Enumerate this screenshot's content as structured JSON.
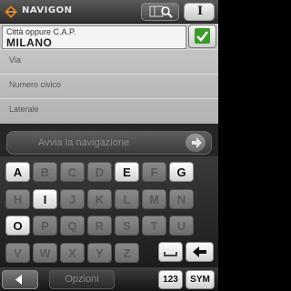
{
  "header": {
    "brand": "NAVIGON",
    "search_icon": "map-search-icon",
    "info_label": "I"
  },
  "form": {
    "city_label": "Città oppure C.A.P.",
    "city_value": "MILANO",
    "ok_icon": "checkmark-icon",
    "street_placeholder": "Via",
    "house_number_placeholder": "Numero civico",
    "cross_street_placeholder": "Laterale"
  },
  "start_navigation": {
    "label": "Avvia la navigazione",
    "icon": "arrow-right-icon"
  },
  "keyboard": {
    "row1": [
      {
        "key": "A",
        "enabled": true
      },
      {
        "key": "B",
        "enabled": false
      },
      {
        "key": "C",
        "enabled": false
      },
      {
        "key": "D",
        "enabled": false
      },
      {
        "key": "E",
        "enabled": true
      },
      {
        "key": "F",
        "enabled": false
      },
      {
        "key": "G",
        "enabled": true
      }
    ],
    "row2": [
      {
        "key": "H",
        "enabled": false
      },
      {
        "key": "I",
        "enabled": true
      },
      {
        "key": "J",
        "enabled": false
      },
      {
        "key": "K",
        "enabled": false
      },
      {
        "key": "L",
        "enabled": false
      },
      {
        "key": "M",
        "enabled": false
      },
      {
        "key": "N",
        "enabled": false
      }
    ],
    "row3": [
      {
        "key": "O",
        "enabled": true
      },
      {
        "key": "P",
        "enabled": false
      },
      {
        "key": "Q",
        "enabled": false
      },
      {
        "key": "R",
        "enabled": false
      },
      {
        "key": "S",
        "enabled": false
      },
      {
        "key": "T",
        "enabled": false
      },
      {
        "key": "U",
        "enabled": false
      }
    ],
    "row4": [
      {
        "key": "V",
        "enabled": false
      },
      {
        "key": "W",
        "enabled": false
      },
      {
        "key": "X",
        "enabled": false
      },
      {
        "key": "Y",
        "enabled": false
      },
      {
        "key": "Z",
        "enabled": false
      }
    ],
    "space_icon": "space-icon",
    "backspace_icon": "backspace-arrow-icon"
  },
  "bottom_bar": {
    "back_icon": "back-arrow-icon",
    "options_label": "Opzioni",
    "numeric_label": "123",
    "symbols_label": "SYM"
  }
}
